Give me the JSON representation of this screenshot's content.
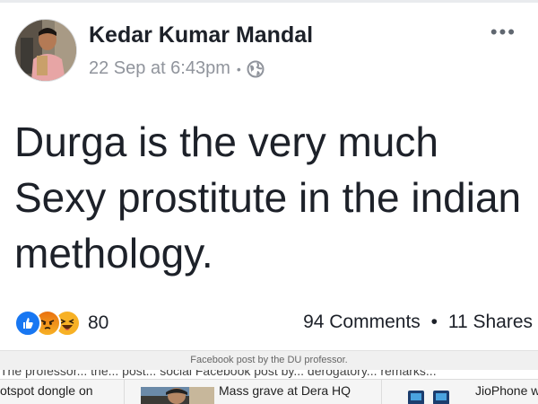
{
  "post": {
    "author": "Kedar Kumar Mandal",
    "timestamp": "22 Sep at 6:43pm",
    "separator": "•",
    "privacy_icon": "globe-icon",
    "more_label": "•••",
    "body_lines": [
      "Durga is the very much",
      "Sexy prostitute in the indian",
      "methology."
    ],
    "reaction_icons": [
      "like-icon",
      "angry-icon",
      "haha-icon"
    ],
    "reaction_count": "80",
    "comments": "94 Comments",
    "shares_separator": "•",
    "shares": "11 Shares"
  },
  "caption": "Facebook post by the DU professor.",
  "cutline": "The professor... the... post... social Facebook post by... derogatory... remarks...",
  "related": {
    "items": [
      {
        "title": "otspot dongle on",
        "sub": ""
      },
      {
        "title": "Mass grave at Dera HQ",
        "sub": ""
      },
      {
        "title": "JioPhone w",
        "sub": ""
      }
    ]
  },
  "colors": {
    "like": "#1877f2",
    "angry": "#e9710f",
    "haha": "#f7b125",
    "text": "#1d2129",
    "muted": "#90949c"
  }
}
